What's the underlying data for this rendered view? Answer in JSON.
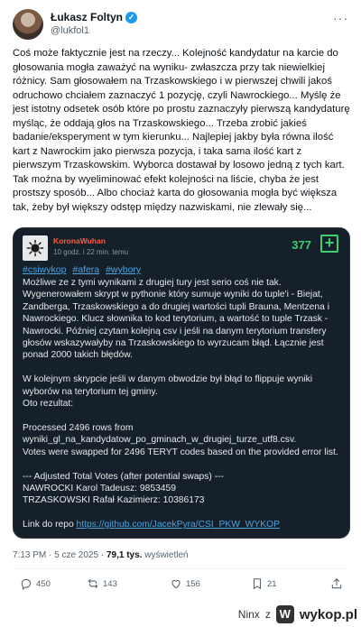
{
  "header": {
    "name": "Łukasz Foltyn",
    "handle": "@lukfol1",
    "more_label": "···"
  },
  "tweet_text": "Coś może faktycznie jest na rzeczy... Kolejność kandydatur na karcie do głosowania mogła zaważyć na wyniku- zwłaszcza przy tak niewielkiej różnicy. Sam głosowałem na Trzaskowskiego i w pierwszej chwili jakoś odruchowo chciałem zaznaczyć 1 pozycję, czyli Nawrockiego... Myślę że jest istotny odsetek osób które po prostu zaznaczyły pierwszą kandydaturę myśląc, że oddają głos na Trzaskowskiego... Trzeba zrobić jakieś badanie/eksperyment w tym kierunku... Najlepiej jakby była równa ilość kart z Nawrockim jako pierwsza pozycja, i taka sama ilość kart z pierwszym Trzaskowskim. Wyborca dostawał by losowo jedną z tych kart. Tak można by wyeliminować efekt kolejności na liście, chyba że jest prostszy sposób... Albo chociaż karta do głosowania mogła być większa tak, żeby był większy odstęp między nazwiskami, nie zlewały się...",
  "card": {
    "username": "KoronaWuhan",
    "time": "10 godz. i 22 min. temu",
    "votes": "377",
    "plus": "+",
    "tags": [
      "#csiwykop",
      "#afera",
      "#wybory"
    ],
    "body": "Możliwe ze z tymi wynikami z drugiej tury jest serio coś nie tak. Wygenerowałem skrypt w pythonie który sumuje wyniki do tuple'i - Biejat, Zandberga, Trzaskowskiego a do drugiej wartości tupli Brauna, Mentzena i Nawrockiego. Klucz słownika to kod terytorium, a wartość to tuple Trzask - Nawrocki. Później czytam kolejną csv i jeśli na danym terytorium transfery głosów wskazywałyby na Trzaskowskiego to wyrzucam błąd. Łącznie jest ponad 2000 takich błędów.\n\nW kolejnym skrypcie jeśli w danym obwodzie był błąd to flippuje wyniki wyborów na terytorium tej gminy.\nOto rezultat:\n\nProcessed 2496 rows from wyniki_gl_na_kandydatow_po_gminach_w_drugiej_turze_utf8.csv.\nVotes were swapped for 2496 TERYT codes based on the provided error list.\n\n--- Adjusted Total Votes (after potential swaps) ---\nNAWROCKI Karol Tadeusz: 9853459\nTRZASKOWSKI Rafał Kazimierz: 10386173\n\nLink do repo ",
    "link": "https://github.com/JacekPyra/CSI_PKW_WYKOP"
  },
  "meta": {
    "time": "7:13 PM · 5 cze 2025 · ",
    "views": "79,1 tys.",
    "views_label": " wyświetleń"
  },
  "actions": {
    "replies": "450",
    "reposts": "143",
    "likes": "156",
    "bookmarks": "21"
  },
  "footer": {
    "author": "Ninx",
    "z": "z",
    "site": "wykop.pl"
  },
  "colors": {
    "verified": "#1d9bf0",
    "card_bg": "#15202b",
    "votes_green": "#3cd070",
    "username_red": "#ff5a3c",
    "link_blue": "#4aa3df"
  }
}
